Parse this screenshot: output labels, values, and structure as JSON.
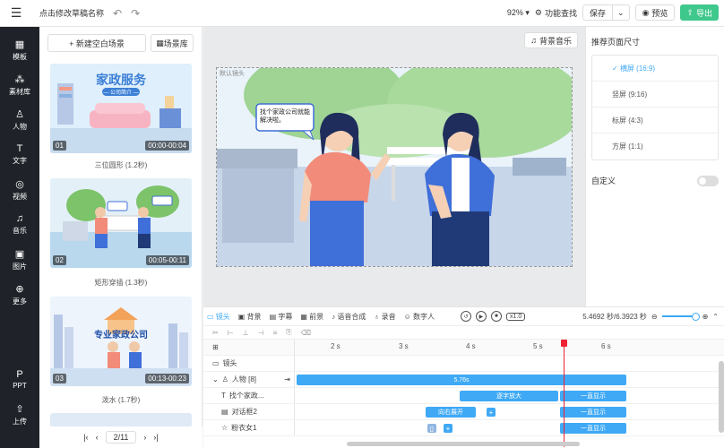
{
  "header": {
    "title": "点击修改草稿名称",
    "zoom": "92%",
    "feature_search": "功能查找",
    "save": "保存",
    "preview": "预览",
    "export": "导出"
  },
  "sidebar": {
    "items": [
      {
        "label": "模板",
        "icon": "template-icon"
      },
      {
        "label": "素材库",
        "icon": "library-icon"
      },
      {
        "label": "人物",
        "icon": "person-icon"
      },
      {
        "label": "文字",
        "icon": "text-icon"
      },
      {
        "label": "视频",
        "icon": "video-icon"
      },
      {
        "label": "音乐",
        "icon": "music-icon"
      },
      {
        "label": "图片",
        "icon": "image-icon"
      },
      {
        "label": "更多",
        "icon": "more-icon"
      },
      {
        "label": "PPT",
        "icon": "ppt-icon"
      },
      {
        "label": "上传",
        "icon": "upload-icon"
      }
    ]
  },
  "scenes_panel": {
    "new_blank": "+ 新建空白场景",
    "library": "场景库",
    "scenes": [
      {
        "num": "01",
        "duration": "00:00-00:04",
        "caption": "三位圆形 (1.2秒)",
        "headline": "家政服务",
        "sub": "— 公司简介 —"
      },
      {
        "num": "02",
        "duration": "00:05-00:11",
        "caption": "矩形穿插 (1.3秒)",
        "headline": "",
        "sub": ""
      },
      {
        "num": "03",
        "duration": "00:13-00:23",
        "caption": "泼水 (1.7秒)",
        "headline": "专业家政公司",
        "sub": ""
      }
    ],
    "pager": "2/11"
  },
  "stage": {
    "bgm": "背景音乐",
    "canvas_label": "默认镜头",
    "bubble_text": "找个家政公司就能解决啦。"
  },
  "right_panel": {
    "title": "推荐页面尺寸",
    "options": [
      {
        "label": "横屏 (16:9)",
        "active": true
      },
      {
        "label": "竖屏 (9:16)",
        "active": false
      },
      {
        "label": "标屏 (4:3)",
        "active": false
      },
      {
        "label": "方屏 (1:1)",
        "active": false
      }
    ],
    "custom": "自定义"
  },
  "timeline": {
    "tabs": [
      "镜头",
      "背景",
      "字幕",
      "前景",
      "语音合成",
      "录音",
      "数字人"
    ],
    "speed": "x1.0",
    "time": "5.4692 秒/6.3923 秒",
    "ruler": [
      "2 s",
      "3 s",
      "4 s",
      "5 s",
      "6 s"
    ],
    "rows": [
      {
        "label": "镜头",
        "icon": "camera-icon"
      },
      {
        "label": "人物 [8]",
        "icon": "person-group-icon"
      },
      {
        "label": "找个家政...",
        "icon": "text-icon"
      },
      {
        "label": "对话框2",
        "icon": "dialog-icon"
      },
      {
        "label": "粉衣女1",
        "icon": "person-icon"
      }
    ],
    "clip_person": "5.76s",
    "clip_typing": "逐字放大",
    "clip_show": "一直显示",
    "clip_expand": "向右展开"
  }
}
